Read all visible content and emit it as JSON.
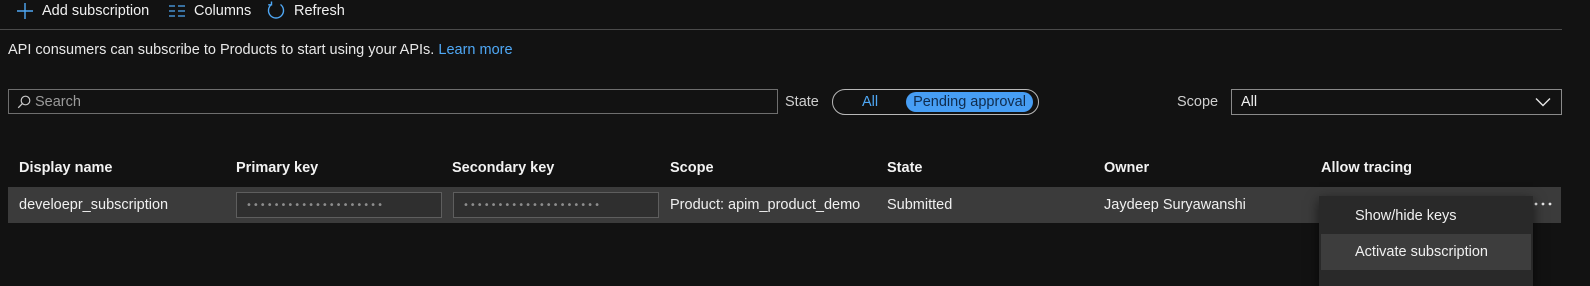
{
  "toolbar": {
    "add_label": "Add subscription",
    "columns_label": "Columns",
    "refresh_label": "Refresh"
  },
  "info": {
    "text": "API consumers can subscribe to Products to start using your APIs.",
    "link": "Learn more"
  },
  "filters": {
    "search_placeholder": "Search",
    "state_label": "State",
    "state_options": [
      "All",
      "Pending approval"
    ],
    "state_selected": "Pending approval",
    "scope_label": "Scope",
    "scope_value": "All"
  },
  "table": {
    "columns": [
      "Display name",
      "Primary key",
      "Secondary key",
      "Scope",
      "State",
      "Owner",
      "Allow tracing"
    ],
    "rows": [
      {
        "display_name": "develoepr_subscription",
        "primary_key": "••••••••••••••••••••",
        "secondary_key": "••••••••••••••••••••",
        "scope": "Product: apim_product_demo",
        "state": "Submitted",
        "owner": "Jaydeep Suryawanshi"
      }
    ]
  },
  "context_menu": {
    "items": [
      "Show/hide keys",
      "Activate subscription"
    ]
  },
  "colors": {
    "accent": "#479ef5",
    "link": "#4fa8f5",
    "background": "#121212",
    "row": "#3b3b3b"
  }
}
